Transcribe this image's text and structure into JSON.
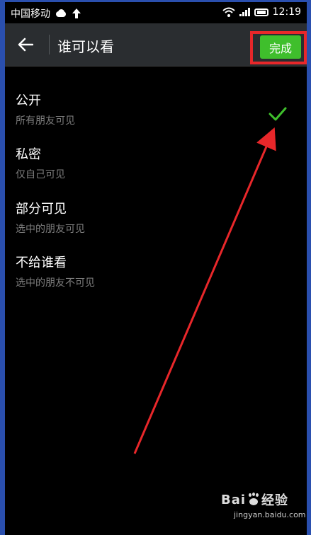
{
  "status_bar": {
    "carrier": "中国移动",
    "time": "12:19",
    "icons": [
      "cloud-icon",
      "upload-arrow-icon",
      "wifi-icon",
      "signal-icon",
      "battery-icon"
    ]
  },
  "header": {
    "back_icon": "back-arrow-icon",
    "title": "谁可以看",
    "done_label": "完成"
  },
  "options": [
    {
      "label": "公开",
      "description": "所有朋友可见",
      "selected": true
    },
    {
      "label": "私密",
      "description": "仅自己可见",
      "selected": false
    },
    {
      "label": "部分可见",
      "description": "选中的朋友可见",
      "selected": false
    },
    {
      "label": "不给谁看",
      "description": "选中的朋友不可见",
      "selected": false
    }
  ],
  "watermark": {
    "brand_left": "Bai",
    "brand_right": "经验",
    "url": "jingyan.baidu.com"
  },
  "colors": {
    "accent": "#3fbf2c",
    "annotation": "#e8272a",
    "header_bg": "#2a2d30",
    "background": "#000000",
    "secondary_text": "#7d7d7d"
  }
}
